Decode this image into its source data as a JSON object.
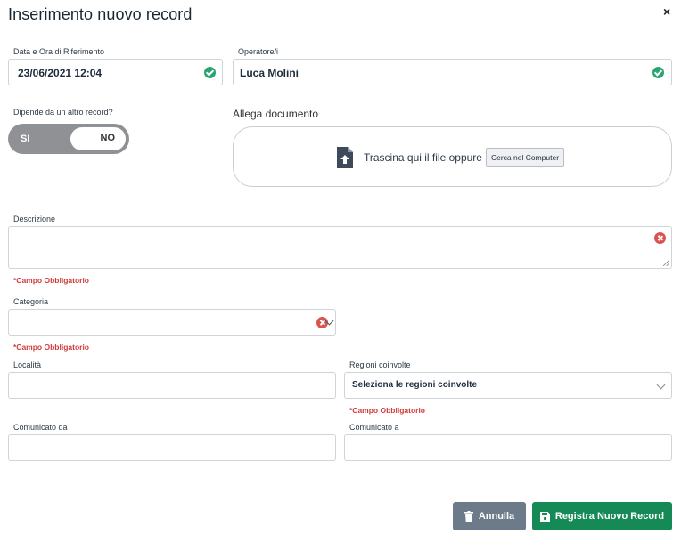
{
  "modal": {
    "title": "Inserimento nuovo record",
    "close_glyph": "×"
  },
  "fields": {
    "data_ora": {
      "label": "Data e Ora di Riferimento",
      "value": "23/06/2021 12:04",
      "status": "valid"
    },
    "operatore": {
      "label": "Operatore/i",
      "value": "Luca Molini",
      "status": "valid"
    },
    "dipende": {
      "label": "Dipende da un altro record?",
      "option_on": "SI",
      "option_off": "NO",
      "selected": "NO"
    },
    "allega": {
      "label": "Allega documento",
      "drop_text": "Trascina qui il file oppure",
      "browse_label": "Cerca nel Computer",
      "icon": "file-upload-icon"
    },
    "descrizione": {
      "label": "Descrizione",
      "value": "",
      "required_msg": "*Campo Obbligatorio",
      "status": "error"
    },
    "categoria": {
      "label": "Categoria",
      "value": "",
      "required_msg": "*Campo Obbligatorio",
      "status": "error"
    },
    "localita": {
      "label": "Località",
      "value": ""
    },
    "regioni": {
      "label": "Regioni coinvolte",
      "placeholder": "Seleziona le regioni coinvolte",
      "required_msg": "*Campo Obbligatorio"
    },
    "comunicato_da": {
      "label": "Comunicato da",
      "value": ""
    },
    "comunicato_a": {
      "label": "Comunicato a",
      "value": ""
    }
  },
  "actions": {
    "cancel_label": "Annulla",
    "save_label": "Registra Nuovo Record"
  },
  "colors": {
    "success": "#2aa56f",
    "error": "#d9534f",
    "required_text": "#d23b3b",
    "primary": "#158a57",
    "secondary": "#6c7a89",
    "toggle_track": "#8f9194"
  }
}
